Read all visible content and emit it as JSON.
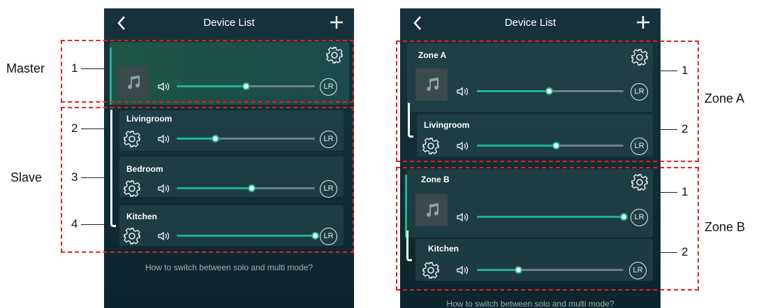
{
  "colors": {
    "accent": "#1fb390",
    "annotation": "#e02020",
    "background": "#16333a"
  },
  "left_screen": {
    "header": {
      "title": "Device List"
    },
    "master": {
      "icon": "music-note-icon",
      "volume_percent": 50,
      "channel": "LR"
    },
    "slaves": [
      {
        "name": "Livingroom",
        "volume_percent": 28,
        "channel": "LR"
      },
      {
        "name": "Bedroom",
        "volume_percent": 54,
        "channel": "LR"
      },
      {
        "name": "Kitchen",
        "volume_percent": 100,
        "channel": "LR"
      }
    ],
    "footer_hint": "How to switch between solo and multi mode?"
  },
  "right_screen": {
    "header": {
      "title": "Device List"
    },
    "zones": [
      {
        "name": "Zone A",
        "icon": "music-note-icon",
        "volume_percent": 49,
        "channel": "LR",
        "members": [
          {
            "name": "Livingroom",
            "volume_percent": 54,
            "channel": "LR"
          }
        ]
      },
      {
        "name": "Zone B",
        "icon": "music-note-icon",
        "volume_percent": 100,
        "channel": "LR",
        "members": [
          {
            "name": "Kitchen",
            "volume_percent": 28,
            "channel": "LR"
          }
        ]
      }
    ],
    "footer_hint": "How to switch between solo and multi mode?"
  },
  "annotations": {
    "left": {
      "master_label": "Master",
      "slave_label": "Slave",
      "numbers": [
        "1",
        "2",
        "3",
        "4"
      ]
    },
    "right": {
      "zone_a_label": "Zone A",
      "zone_b_label": "Zone B",
      "zone_a_numbers": [
        "1",
        "2"
      ],
      "zone_b_numbers": [
        "1",
        "2"
      ]
    }
  }
}
